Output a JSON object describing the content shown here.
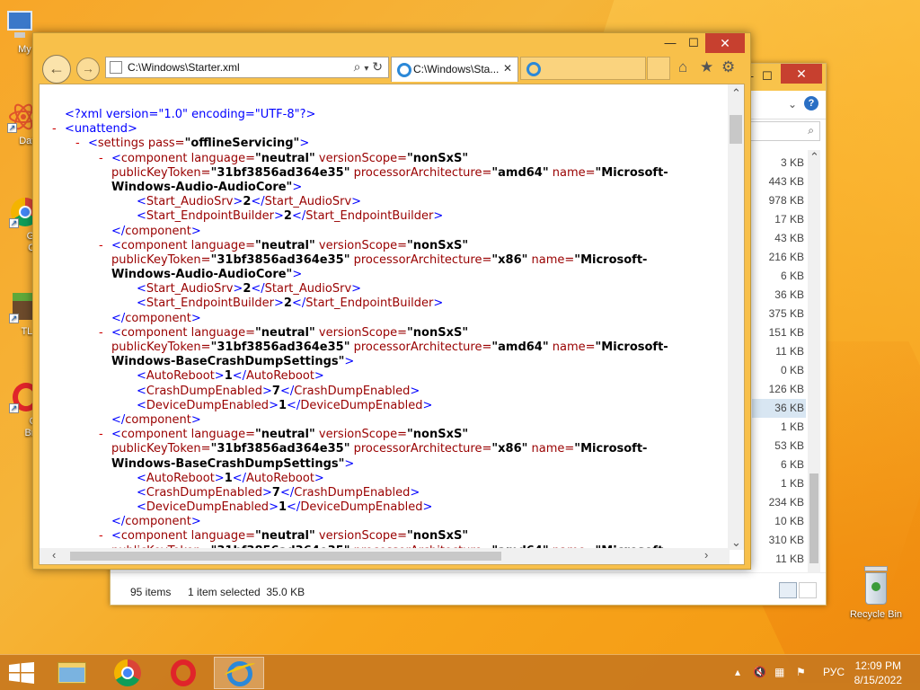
{
  "desktop": {
    "icons": [
      {
        "label": "My Co",
        "icon": "computer-icon"
      },
      {
        "label": "DataW",
        "icon": "atom-icon"
      },
      {
        "label": "Goo Chr",
        "icon": "chrome-icon"
      },
      {
        "label": "TLau",
        "icon": "minecraft-icon"
      },
      {
        "label": "Op Brow",
        "icon": "opera-icon"
      }
    ],
    "recycle_bin": "Recycle Bin"
  },
  "explorer": {
    "sizes": [
      "3 KB",
      "443 KB",
      "978 KB",
      "17 KB",
      "43 KB",
      "216 KB",
      "6 KB",
      "36 KB",
      "375 KB",
      "151 KB",
      "11 KB",
      "0 KB",
      "126 KB",
      "36 KB",
      "1 KB",
      "53 KB",
      "6 KB",
      "1 KB",
      "234 KB",
      "10 KB",
      "310 KB",
      "11 KB"
    ],
    "selected_size_index": 13,
    "status_items": "95 items",
    "status_selected": "1 item selected  35.0 KB"
  },
  "ie": {
    "address": "C:\\Windows\\Starter.xml",
    "tab_title": "C:\\Windows\\Sta...",
    "accent": "#f8c04a"
  },
  "xml": {
    "decl": "<?xml version=\"1.0\" encoding=\"UTF-8\"?>",
    "unattend_open": "<unattend>",
    "settings_tag": "settings",
    "settings_attr": "pass=",
    "settings_val": "\"offlineServicing\"",
    "dash": "-",
    "comp_tag": "component",
    "lang_attr": "language=",
    "lang_val": "\"neutral\"",
    "vs_attr": "versionScope=",
    "vs_val": "\"nonSxS\"",
    "pkt_attr": "publicKeyToken=",
    "pkt_val": "\"31bf3856ad364e35\"",
    "arch_attr": "processorArchitecture=",
    "arch_amd64": "\"amd64\"",
    "arch_x86": "\"x86\"",
    "name_attr": "name=",
    "name_ms": "\"Microsoft-",
    "name_audio": "Windows-Audio-AudioCore\"",
    "name_crash": "Windows-BaseCrashDumpSettings\"",
    "comp_close": "</component>",
    "audiosrv_open": "<Start_AudioSrv>",
    "audiosrv_close": "</Start_AudioSrv>",
    "audiosrv_val": "2",
    "endpoint_open": "<Start_EndpointBuilder>",
    "endpoint_close": "</Start_EndpointBuilder>",
    "endpoint_val": "2",
    "autoreboot_open": "<AutoReboot>",
    "autoreboot_close": "</AutoReboot>",
    "autoreboot_val": "1",
    "crash_open": "<CrashDumpEnabled>",
    "crash_close": "</CrashDumpEnabled>",
    "crash_val": "7",
    "device_open": "<DeviceDumpEnabled>",
    "device_close": "</DeviceDumpEnabled>",
    "device_val": "1"
  },
  "taskbar": {
    "lang": "РУС",
    "time": "12:09 PM",
    "date": "8/15/2022"
  }
}
